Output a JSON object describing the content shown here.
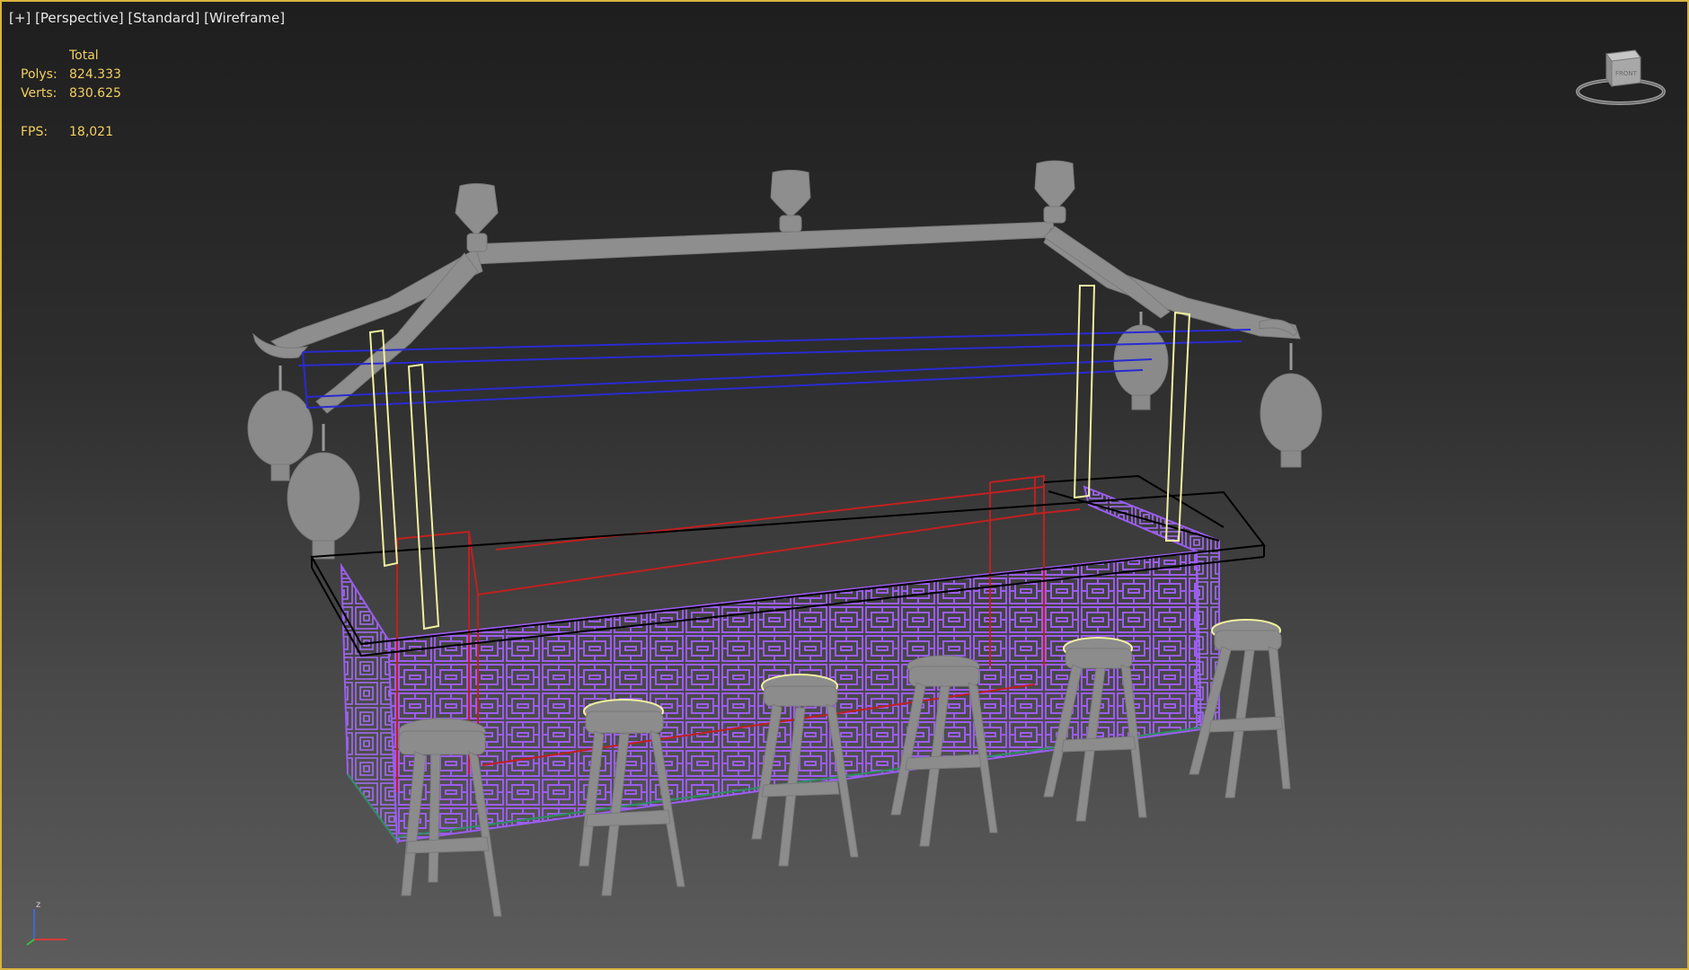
{
  "viewport": {
    "label_plus": "[+]",
    "label_view": "[Perspective]",
    "label_shading": "[Standard]",
    "label_mode": "[Wireframe]"
  },
  "stats": {
    "header": "Total",
    "polys_label": "Polys:",
    "polys_value": "824.333",
    "verts_label": "Verts:",
    "verts_value": "830.625",
    "fps_label": "FPS:",
    "fps_value": "18,021"
  },
  "viewcube": {
    "face_label": "FRONT"
  },
  "axis": {
    "z_label": "z"
  },
  "colors": {
    "accent_border": "#d9b43c",
    "stats_text": "#f2d060",
    "wire_purple": "#9b5cf0",
    "wire_red": "#c02020",
    "wire_blue": "#2a2ad0",
    "wire_black": "#000000",
    "wire_yellow": "#f0f0a0",
    "solid_gray": "#8a8a8a"
  },
  "scene": {
    "objects": [
      "roof-frame",
      "lanterns",
      "bar-counter",
      "counter-top",
      "support-posts",
      "bar-stools"
    ]
  }
}
